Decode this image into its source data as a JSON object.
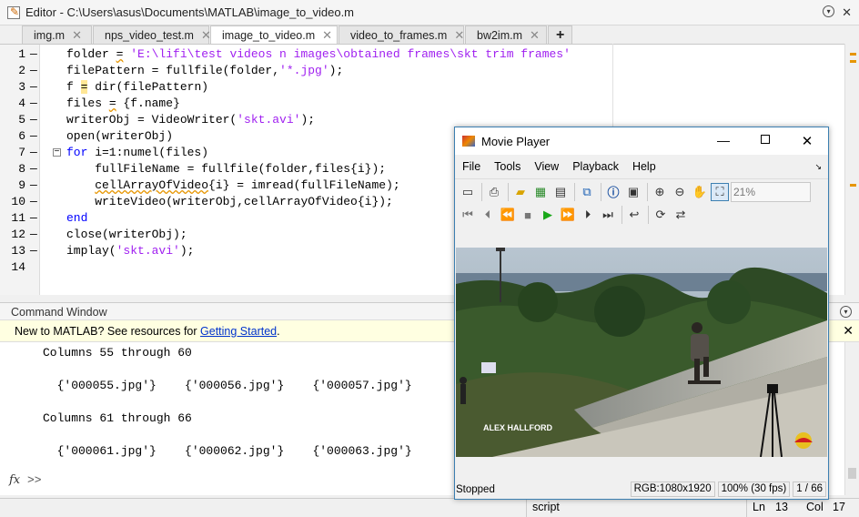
{
  "editor": {
    "title": "Editor - C:\\Users\\asus\\Documents\\MATLAB\\image_to_video.m",
    "tabs": [
      {
        "label": "img.m"
      },
      {
        "label": "nps_video_test.m"
      },
      {
        "label": "image_to_video.m",
        "active": true
      },
      {
        "label": "video_to_frames.m"
      },
      {
        "label": "bw2im.m"
      }
    ],
    "add_tab": "+",
    "lines": [
      {
        "n": "1",
        "text": "folder = 'E:\\lifi\\test videos n images\\obtained frames\\skt trim frames'"
      },
      {
        "n": "2",
        "text": "filePattern = fullfile(folder,'*.jpg');"
      },
      {
        "n": "3",
        "text": "f = dir(filePattern)"
      },
      {
        "n": "4",
        "text": "files = {f.name}"
      },
      {
        "n": "5",
        "text": "writerObj = VideoWriter('skt.avi');"
      },
      {
        "n": "6",
        "text": "open(writerObj)"
      },
      {
        "n": "7",
        "text": "for i=1:numel(files)"
      },
      {
        "n": "8",
        "text": "    fullFileName = fullfile(folder,files{i});"
      },
      {
        "n": "9",
        "text": "    cellArrayOfVideo{i} = imread(fullFileName);"
      },
      {
        "n": "10",
        "text": "    writeVideo(writerObj,cellArrayOfVideo{i});"
      },
      {
        "n": "11",
        "text": "end"
      },
      {
        "n": "12",
        "text": "close(writerObj);"
      },
      {
        "n": "13",
        "text": "implay('skt.avi');"
      },
      {
        "n": "14",
        "text": ""
      }
    ]
  },
  "command_window": {
    "title": "Command Window",
    "banner_text": "New to MATLAB? See resources for ",
    "banner_link": "Getting Started",
    "banner_end": ".",
    "lines": [
      "Columns 55 through 60",
      "  {'000055.jpg'}    {'000056.jpg'}    {'000057.jpg'}",
      "Columns 61 through 66",
      "  {'000061.jpg'}    {'000062.jpg'}    {'000063.jpg'}"
    ],
    "prompt": ">>"
  },
  "status_bar": {
    "mode": "script",
    "ln_label": "Ln",
    "ln": "13",
    "col_label": "Col",
    "col": "17"
  },
  "movie_player": {
    "title": "Movie Player",
    "menu": [
      "File",
      "Tools",
      "View",
      "Playback",
      "Help"
    ],
    "zoom": "21%",
    "overlay_text": "ALEX HALLFORD",
    "status": "Stopped",
    "resolution": "RGB:1080x1920",
    "rate": "100% (30 fps)",
    "frame": "1 / 66"
  }
}
